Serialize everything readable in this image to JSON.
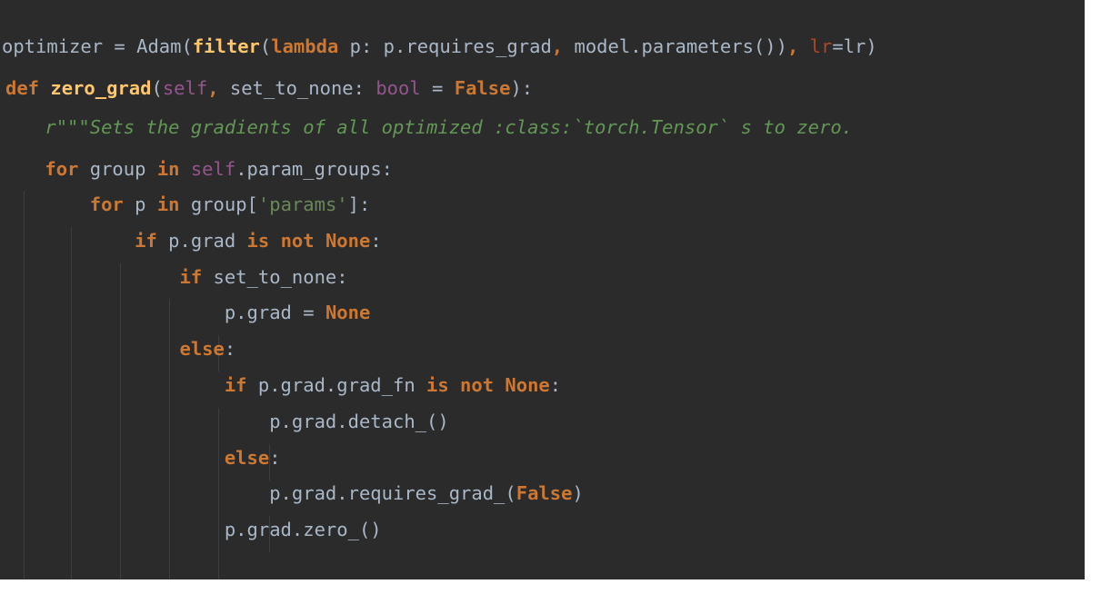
{
  "editor": {
    "lines": [
      {
        "indent": "",
        "tokens": [
          {
            "t": "optimizer = Adam(",
            "k": "plain"
          },
          {
            "t": "filter",
            "k": "fn"
          },
          {
            "t": "(",
            "k": "plain"
          },
          {
            "t": "lambda",
            "k": "kw"
          },
          {
            "t": " p: p.requires_grad",
            "k": "plain"
          },
          {
            "t": ",",
            "k": "kw"
          },
          {
            "t": " model.parameters())",
            "k": "plain"
          },
          {
            "t": ",",
            "k": "kw"
          },
          {
            "t": " ",
            "k": "plain"
          },
          {
            "t": "lr",
            "k": "param"
          },
          {
            "t": "=lr)",
            "k": "plain"
          }
        ]
      },
      {
        "indent": "",
        "tokens": [
          {
            "t": "def",
            "k": "kw"
          },
          {
            "t": " ",
            "k": "plain"
          },
          {
            "t": "zero_grad",
            "k": "fn"
          },
          {
            "t": "(",
            "k": "plain"
          },
          {
            "t": "self",
            "k": "self"
          },
          {
            "t": ",",
            "k": "kw"
          },
          {
            "t": " set_to_none: ",
            "k": "plain"
          },
          {
            "t": "bool",
            "k": "self"
          },
          {
            "t": " = ",
            "k": "plain"
          },
          {
            "t": "False",
            "k": "kw"
          },
          {
            "t": "):",
            "k": "plain"
          }
        ]
      },
      {
        "indent": "    ",
        "tokens": [
          {
            "t": "r\"\"\"Sets the gradients of all optimized :class:`torch.Tensor` s to zero.",
            "k": "doc"
          }
        ]
      },
      {
        "indent": "    ",
        "tokens": [
          {
            "t": "for",
            "k": "kw"
          },
          {
            "t": " group ",
            "k": "plain"
          },
          {
            "t": "in",
            "k": "kw"
          },
          {
            "t": " ",
            "k": "plain"
          },
          {
            "t": "self",
            "k": "self"
          },
          {
            "t": ".param_groups:",
            "k": "plain"
          }
        ]
      },
      {
        "indent": "        ",
        "tokens": [
          {
            "t": "for",
            "k": "kw"
          },
          {
            "t": " p ",
            "k": "plain"
          },
          {
            "t": "in",
            "k": "kw"
          },
          {
            "t": " group[",
            "k": "plain"
          },
          {
            "t": "'params'",
            "k": "str"
          },
          {
            "t": "]:",
            "k": "plain"
          }
        ]
      },
      {
        "indent": "            ",
        "tokens": [
          {
            "t": "if",
            "k": "kw"
          },
          {
            "t": " p.grad ",
            "k": "plain"
          },
          {
            "t": "is not None",
            "k": "kw"
          },
          {
            "t": ":",
            "k": "plain"
          }
        ]
      },
      {
        "indent": "                ",
        "tokens": [
          {
            "t": "if",
            "k": "kw"
          },
          {
            "t": " set_to_none:",
            "k": "plain"
          }
        ]
      },
      {
        "indent": "                    ",
        "tokens": [
          {
            "t": "p.grad = ",
            "k": "plain"
          },
          {
            "t": "None",
            "k": "kw"
          }
        ]
      },
      {
        "indent": "                ",
        "tokens": [
          {
            "t": "else",
            "k": "kw"
          },
          {
            "t": ":",
            "k": "plain"
          }
        ]
      },
      {
        "indent": "                    ",
        "tokens": [
          {
            "t": "if",
            "k": "kw"
          },
          {
            "t": " p.grad.grad_fn ",
            "k": "plain"
          },
          {
            "t": "is not None",
            "k": "kw"
          },
          {
            "t": ":",
            "k": "plain"
          }
        ]
      },
      {
        "indent": "                        ",
        "tokens": [
          {
            "t": "p.grad.detach_()",
            "k": "plain"
          }
        ]
      },
      {
        "indent": "                    ",
        "tokens": [
          {
            "t": "else",
            "k": "kw"
          },
          {
            "t": ":",
            "k": "plain"
          }
        ]
      },
      {
        "indent": "                        ",
        "tokens": [
          {
            "t": "p.grad.requires_grad_(",
            "k": "plain"
          },
          {
            "t": "False",
            "k": "kw"
          },
          {
            "t": ")",
            "k": "plain"
          }
        ]
      },
      {
        "indent": "                    ",
        "tokens": [
          {
            "t": "p.grad.zero_()",
            "k": "plain"
          }
        ]
      }
    ]
  },
  "colors": {
    "background": "#2b2b2b",
    "keyword": "#cc7832",
    "function": "#ffc66d",
    "self": "#94558d",
    "param": "#aa4926",
    "string": "#6a8759",
    "docstring": "#629755",
    "text": "#a9b7c6"
  }
}
